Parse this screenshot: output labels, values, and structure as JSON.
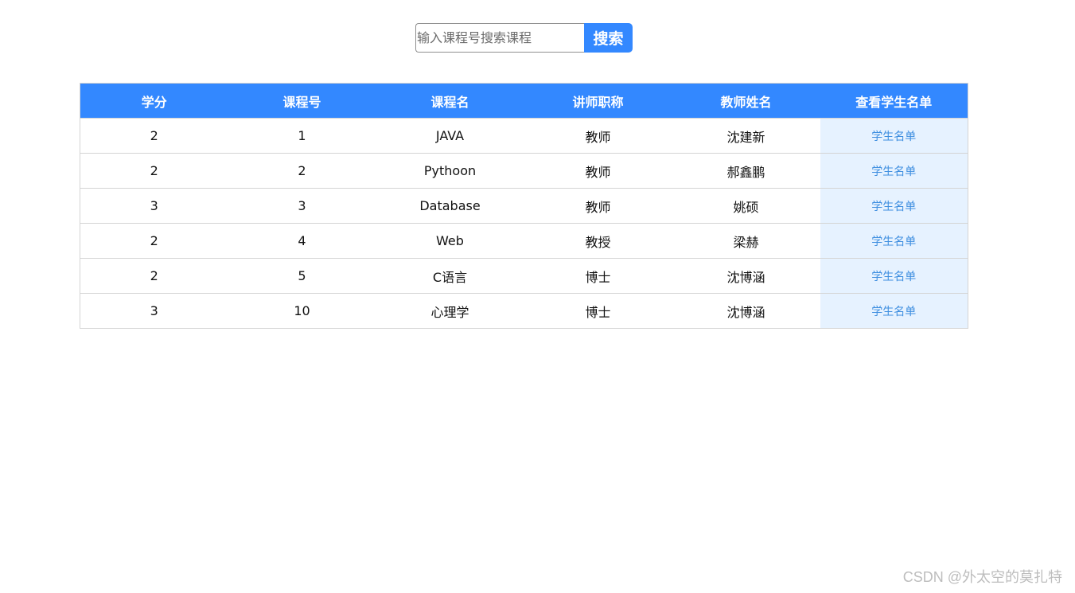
{
  "search": {
    "placeholder": "输入课程号搜索课程",
    "value": "",
    "button_label": "搜索"
  },
  "table": {
    "columns": [
      "学分",
      "课程号",
      "课程名",
      "讲师职称",
      "教师姓名",
      "查看学生名单"
    ],
    "rows": [
      {
        "credit": "2",
        "course_id": "1",
        "course_name": "JAVA",
        "title": "教师",
        "teacher": "沈建新",
        "link": "学生名单"
      },
      {
        "credit": "2",
        "course_id": "2",
        "course_name": "Pythoon",
        "title": "教师",
        "teacher": "郝鑫鹏",
        "link": "学生名单"
      },
      {
        "credit": "3",
        "course_id": "3",
        "course_name": "Database",
        "title": "教师",
        "teacher": "姚硕",
        "link": "学生名单"
      },
      {
        "credit": "2",
        "course_id": "4",
        "course_name": "Web",
        "title": "教授",
        "teacher": "梁赫",
        "link": "学生名单"
      },
      {
        "credit": "2",
        "course_id": "5",
        "course_name": "C语言",
        "title": "博士",
        "teacher": "沈博涵",
        "link": "学生名单"
      },
      {
        "credit": "3",
        "course_id": "10",
        "course_name": "心理学",
        "title": "博士",
        "teacher": "沈博涵",
        "link": "学生名单"
      }
    ]
  },
  "watermark": "CSDN @外太空的莫扎特",
  "colors": {
    "accent": "#3388ff",
    "link": "#3f8fe0",
    "link_cell_bg": "#e6f2ff",
    "border": "#d4d4d4"
  }
}
